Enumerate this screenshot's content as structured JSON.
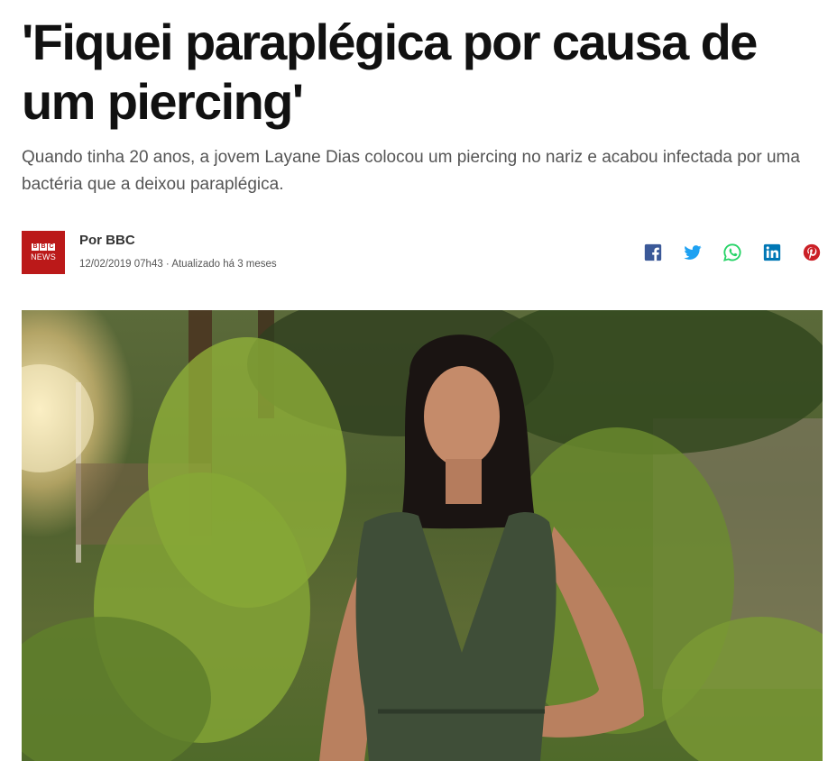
{
  "article": {
    "headline": "'Fiquei paraplégica por causa de um piercing'",
    "standfirst": "Quando tinha 20 anos, a jovem Layane Dias colocou um piercing no nariz e acabou infectada por uma bactéria que a deixou paraplégica.",
    "byline": {
      "author": "Por BBC",
      "meta": "12/02/2019 07h43 · Atualizado há 3 meses",
      "logo": {
        "letters": [
          "B",
          "B",
          "C"
        ],
        "word": "NEWS",
        "color": "#bb1919"
      }
    },
    "share": [
      {
        "icon": "facebook-icon",
        "color": "#3b5998"
      },
      {
        "icon": "twitter-icon",
        "color": "#1da1f2"
      },
      {
        "icon": "whatsapp-icon",
        "color": "#25d366"
      },
      {
        "icon": "linkedin-icon",
        "color": "#0077b5"
      },
      {
        "icon": "pinterest-icon",
        "color": "#cb2027"
      }
    ],
    "image": {
      "subject": "photo"
    }
  }
}
